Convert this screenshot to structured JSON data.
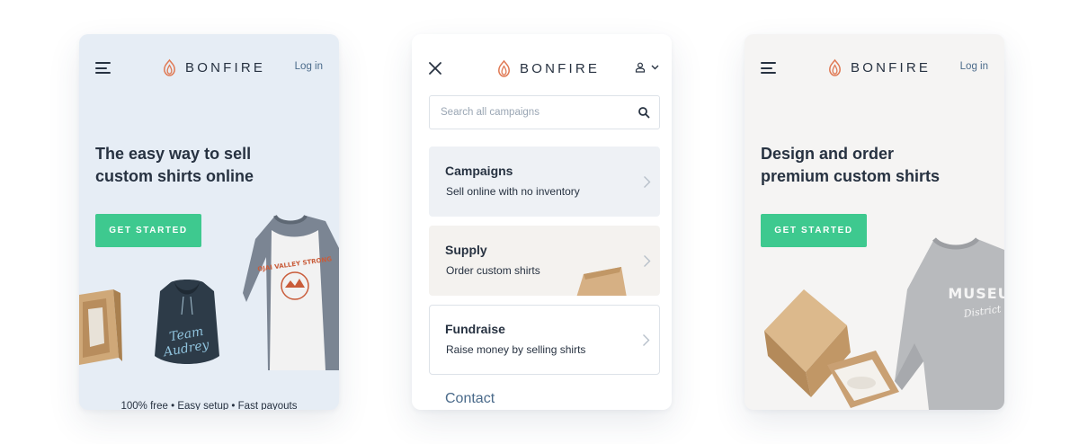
{
  "colors": {
    "accent": "#3ec98f",
    "brand_logo": "#e07a55",
    "text_dark": "#273241",
    "link": "#4a6a8a",
    "phone1_bg": "#e6edf5",
    "phone3_bg": "#f5f4f3"
  },
  "screens": [
    {
      "header": {
        "menu_icon": "hamburger-icon",
        "logo_icon": "bonfire-flame-icon",
        "brand": "BONFIRE",
        "login": "Log in"
      },
      "hero": {
        "title_line1": "The easy way to sell",
        "title_line2": "custom shirts online",
        "cta": "GET STARTED"
      },
      "illustration": {
        "shirt_print_line": "OJAI VALLEY STRONG",
        "hoodie_text_line1": "Team",
        "hoodie_text_line2": "Audrey"
      },
      "footnote": "100% free • Easy setup • Fast payouts"
    },
    {
      "header": {
        "close_icon": "close-icon",
        "logo_icon": "bonfire-flame-icon",
        "brand": "BONFIRE",
        "account_icon": "user-icon",
        "dropdown_icon": "chevron-down-icon"
      },
      "search": {
        "placeholder": "Search all campaigns",
        "icon": "search-icon"
      },
      "menu": [
        {
          "title": "Campaigns",
          "subtitle": "Sell online with no inventory"
        },
        {
          "title": "Supply",
          "subtitle": "Order custom shirts"
        },
        {
          "title": "Fundraise",
          "subtitle": "Raise money by selling shirts"
        }
      ],
      "contact": "Contact"
    },
    {
      "header": {
        "menu_icon": "hamburger-icon",
        "logo_icon": "bonfire-flame-icon",
        "brand": "BONFIRE",
        "login": "Log in"
      },
      "hero": {
        "title_line1": "Design and order",
        "title_line2": "premium custom shirts",
        "cta": "GET STARTED"
      },
      "illustration": {
        "sweatshirt_text_line1": "MUSEU",
        "sweatshirt_text_line2": "District"
      }
    }
  ]
}
